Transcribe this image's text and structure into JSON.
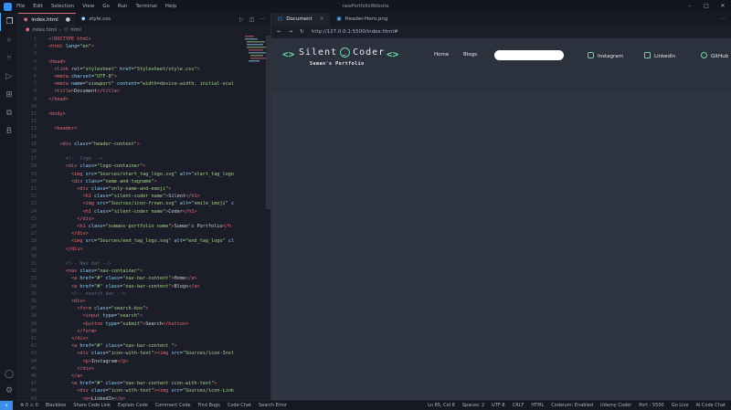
{
  "titlebar": {
    "menu": [
      "File",
      "Edit",
      "Selection",
      "View",
      "Go",
      "Run",
      "Terminal",
      "Help"
    ],
    "title": "newPortfolioWebsite"
  },
  "editor": {
    "tabs": [
      {
        "label": "index.html",
        "icon": "html5-icon",
        "modified": true
      },
      {
        "label": "style.css",
        "icon": "css-icon"
      }
    ],
    "breadcrumb": [
      "index.html",
      "html"
    ],
    "lines": [
      {
        "n": "1",
        "html": "<span class=\"tg\">&lt;!DOCTYPE html&gt;</span>"
      },
      {
        "n": "2",
        "html": "<span class=\"tg\">&lt;html</span> <span class=\"at\">lang</span>=<span class=\"st\">\"en\"</span><span class=\"tg\">&gt;</span>"
      },
      {
        "n": "3",
        "html": ""
      },
      {
        "n": "4",
        "html": "<span class=\"tg\">&lt;head&gt;</span>"
      },
      {
        "n": "5",
        "html": "  <span class=\"tg\">&lt;link</span> <span class=\"at\">rel</span>=<span class=\"st\">\"stylesheet\"</span> <span class=\"at\">href</span>=<span class=\"st\">\"Stylesheet/style.css\"</span><span class=\"tg\">&gt;</span>"
      },
      {
        "n": "6",
        "html": "  <span class=\"tg\">&lt;meta</span> <span class=\"at\">charset</span>=<span class=\"st\">\"UTF-8\"</span><span class=\"tg\">&gt;</span>"
      },
      {
        "n": "7",
        "html": "  <span class=\"tg\">&lt;meta</span> <span class=\"at\">name</span>=<span class=\"st\">\"viewport\"</span> <span class=\"at\">content</span>=<span class=\"st\">\"width=device-width, initial-scal</span>"
      },
      {
        "n": "8",
        "html": "  <span class=\"tg\">&lt;title&gt;</span>Document<span class=\"tg\">&lt;/title&gt;</span>"
      },
      {
        "n": "9",
        "html": "<span class=\"tg\">&lt;/head&gt;</span>"
      },
      {
        "n": "10",
        "html": ""
      },
      {
        "n": "11",
        "html": "<span class=\"tg\">&lt;body&gt;</span>"
      },
      {
        "n": "12",
        "html": ""
      },
      {
        "n": "13",
        "html": "  <span class=\"tg\">&lt;header&gt;</span>"
      },
      {
        "n": "14",
        "html": ""
      },
      {
        "n": "15",
        "html": "    <span class=\"tg\">&lt;div</span> <span class=\"at\">class</span>=<span class=\"st\">\"header-content\"</span><span class=\"tg\">&gt;</span>"
      },
      {
        "n": "16",
        "html": ""
      },
      {
        "n": "17",
        "html": "      <span class=\"cm\">&lt;!-- logo --&gt;</span>"
      },
      {
        "n": "18",
        "html": "      <span class=\"tg\">&lt;div</span> <span class=\"at\">class</span>=<span class=\"st\">\"logo-container\"</span><span class=\"tg\">&gt;</span>"
      },
      {
        "n": "19",
        "html": "        <span class=\"tg\">&lt;img</span> <span class=\"at\">src</span>=<span class=\"st\">\"Sources/start_tag_logo.svg\"</span> <span class=\"at\">alt</span>=<span class=\"st\">\"start_tag_logo</span>"
      },
      {
        "n": "20",
        "html": "        <span class=\"tg\">&lt;div</span> <span class=\"at\">class</span>=<span class=\"st\">\"name-and-tagname\"</span><span class=\"tg\">&gt;</span>"
      },
      {
        "n": "21",
        "html": "          <span class=\"tg\">&lt;div</span> <span class=\"at\">class</span>=<span class=\"st\">\"only-name-and-emoji\"</span><span class=\"tg\">&gt;</span>"
      },
      {
        "n": "22",
        "html": "            <span class=\"tg\">&lt;h1</span> <span class=\"at\">class</span>=<span class=\"st\">\"silent-coder name\"</span><span class=\"tg\">&gt;</span>Silent<span class=\"tg\">&lt;/h1&gt;</span>"
      },
      {
        "n": "23",
        "html": "            <span class=\"tg\">&lt;img</span> <span class=\"at\">src</span>=<span class=\"st\">\"Sources/icon-frown.svg\"</span> <span class=\"at\">alt</span>=<span class=\"st\">\"smile_imoji\"</span> <span class=\"at\">c</span>"
      },
      {
        "n": "24",
        "html": "            <span class=\"tg\">&lt;h1</span> <span class=\"at\">class</span>=<span class=\"st\">\"silent-coder name\"</span><span class=\"tg\">&gt;</span>Coder<span class=\"tg\">&lt;/h1&gt;</span>"
      },
      {
        "n": "25",
        "html": "          <span class=\"tg\">&lt;/div&gt;</span>"
      },
      {
        "n": "26",
        "html": "          <span class=\"tg\">&lt;h1</span> <span class=\"at\">class</span>=<span class=\"st\">\"sumans-portfolio name\"</span><span class=\"tg\">&gt;</span>Suman's Portfolio<span class=\"tg\">&lt;/h</span>"
      },
      {
        "n": "27",
        "html": "        <span class=\"tg\">&lt;/div&gt;</span>"
      },
      {
        "n": "28",
        "html": "        <span class=\"tg\">&lt;img</span> <span class=\"at\">src</span>=<span class=\"st\">\"Sources/end_tag_logo.svg\"</span> <span class=\"at\">alt</span>=<span class=\"st\">\"end_tag_logo\"</span> <span class=\"at\">cl</span>"
      },
      {
        "n": "29",
        "html": "      <span class=\"tg\">&lt;/div&gt;</span>"
      },
      {
        "n": "30",
        "html": ""
      },
      {
        "n": "31",
        "html": "      <span class=\"cm\">&lt;!-- Nav bar --&gt;</span>"
      },
      {
        "n": "32",
        "html": "      <span class=\"tg\">&lt;nav</span> <span class=\"at\">class</span>=<span class=\"st\">\"nav-container\"</span><span class=\"tg\">&gt;</span>"
      },
      {
        "n": "33",
        "html": "        <span class=\"tg\">&lt;a</span> <span class=\"at\">href</span>=<span class=\"st\">\"#\"</span> <span class=\"at\">class</span>=<span class=\"st\">\"nav-bar-content\"</span><span class=\"tg\">&gt;</span>Home<span class=\"tg\">&lt;/a&gt;</span>"
      },
      {
        "n": "34",
        "html": "        <span class=\"tg\">&lt;a</span> <span class=\"at\">href</span>=<span class=\"st\">\"#\"</span> <span class=\"at\">class</span>=<span class=\"st\">\"nav-bar-content\"</span><span class=\"tg\">&gt;</span>Blogs<span class=\"tg\">&lt;/a&gt;</span>"
      },
      {
        "n": "35",
        "html": "        <span class=\"cm\">&lt;!-- search bar --&gt;</span>"
      },
      {
        "n": "36",
        "html": "        <span class=\"tg\">&lt;div&gt;</span>"
      },
      {
        "n": "37",
        "html": "          <span class=\"tg\">&lt;form</span> <span class=\"at\">class</span>=<span class=\"st\">\"search-box\"</span><span class=\"tg\">&gt;</span>"
      },
      {
        "n": "38",
        "html": "            <span class=\"tg\">&lt;input</span> <span class=\"at\">type</span>=<span class=\"st\">\"search\"</span><span class=\"tg\">&gt;</span>"
      },
      {
        "n": "39",
        "html": "            <span class=\"tg\">&lt;button</span> <span class=\"at\">type</span>=<span class=\"st\">\"submit\"</span><span class=\"tg\">&gt;</span>Search<span class=\"tg\">&lt;/button&gt;</span>"
      },
      {
        "n": "40",
        "html": "          <span class=\"tg\">&lt;/form&gt;</span>"
      },
      {
        "n": "41",
        "html": "        <span class=\"tg\">&lt;/div&gt;</span>"
      },
      {
        "n": "42",
        "html": "        <span class=\"tg\">&lt;a</span> <span class=\"at\">href</span>=<span class=\"st\">\"#\"</span> <span class=\"at\">class</span>=<span class=\"st\">\"nav-bar-content \"</span><span class=\"tg\">&gt;</span>"
      },
      {
        "n": "43",
        "html": "          <span class=\"tg\">&lt;div</span> <span class=\"at\">class</span>=<span class=\"st\">\"icon-with-text\"</span><span class=\"tg\">&gt;&lt;img</span> <span class=\"at\">src</span>=<span class=\"st\">\"Sources/icon-Inst</span>"
      },
      {
        "n": "44",
        "html": "            <span class=\"tg\">&lt;p&gt;</span>Instagram<span class=\"tg\">&lt;/p&gt;</span>"
      },
      {
        "n": "45",
        "html": "          <span class=\"tg\">&lt;/div&gt;</span>"
      },
      {
        "n": "46",
        "html": "        <span class=\"tg\">&lt;/a&gt;</span>"
      },
      {
        "n": "47",
        "html": "        <span class=\"tg\">&lt;a</span> <span class=\"at\">href</span>=<span class=\"st\">\"#\"</span> <span class=\"at\">class</span>=<span class=\"st\">\"nav-bar-content icon-with-text\"</span><span class=\"tg\">&gt;</span>"
      },
      {
        "n": "48",
        "html": "          <span class=\"tg\">&lt;div</span> <span class=\"at\">class</span>=<span class=\"st\">\"icon-with-text\"</span><span class=\"tg\">&gt;&lt;img</span> <span class=\"at\">src</span>=<span class=\"st\">\"Sources/icon-Link</span>"
      },
      {
        "n": "49",
        "html": "            <span class=\"tg\">&lt;p&gt;</span>LinkedIn<span class=\"tg\">&lt;/p&gt;</span>"
      },
      {
        "n": "50",
        "html": "          <span class=\"tg\">&lt;/div&gt;</span>"
      }
    ]
  },
  "preview": {
    "tabs": [
      {
        "label": "Document",
        "icon": "browser-icon"
      },
      {
        "label": "Header-Hero.png",
        "icon": "image-icon"
      }
    ],
    "url": "http://127.0.0.1:5500/index.html#",
    "site": {
      "logo_left": "Silent",
      "logo_right": "Coder",
      "subtitle": "Suman's Portfolio",
      "nav": [
        "Home",
        "Blogs"
      ],
      "social": [
        {
          "label": "Instagram",
          "icon": "instagram-icon"
        },
        {
          "label": "LinkedIn",
          "icon": "linkedin-icon"
        },
        {
          "label": "GitHub",
          "icon": "github-icon"
        }
      ]
    }
  },
  "statusbar": {
    "left": [
      "⊗ 0 ⚠ 0",
      "Blackbox",
      "Share Code Link",
      "Explain Code",
      "Comment Code",
      "Find Bugs",
      "Code Chat",
      "Search Error"
    ],
    "right": [
      "Ln 65, Col 8",
      "Spaces: 2",
      "UTF-8",
      "CRLF",
      "HTML",
      "Codeium: Enabled",
      "Udemy Coder",
      "Port : 5500",
      "Go Live",
      "AI Code Chat"
    ]
  },
  "colors": {
    "accent": "#6dd6a6",
    "page_bg": "#2f3542",
    "editor_bg": "#1b1e28",
    "tag": "#e06c75",
    "attr": "#8cd3f8",
    "string": "#a6d189"
  }
}
